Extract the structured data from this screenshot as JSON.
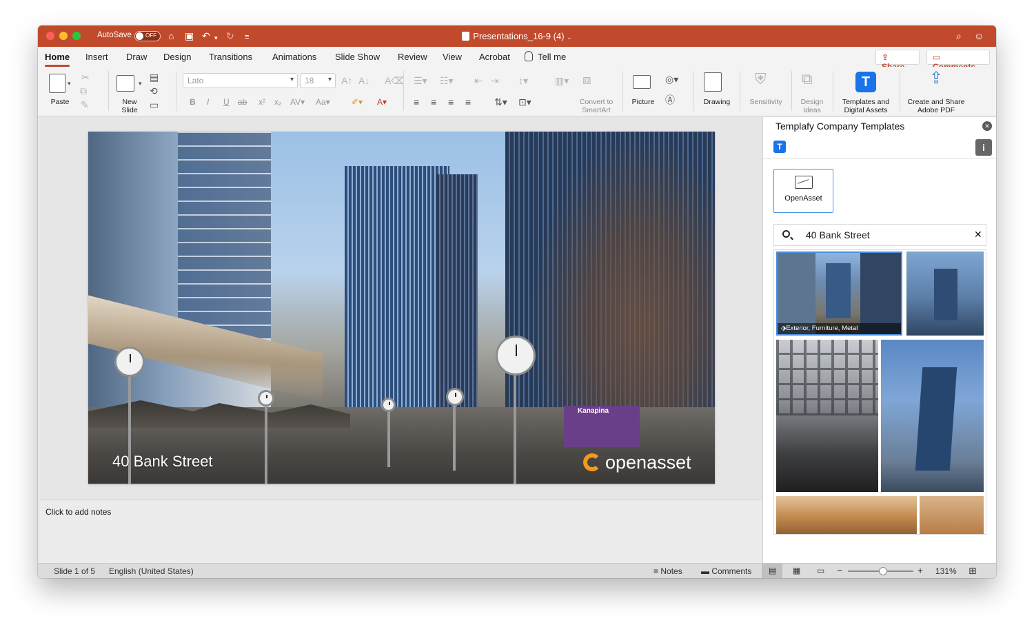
{
  "titlebar": {
    "autosave_label": "AutoSave",
    "autosave_state": "OFF",
    "document_title": "Presentations_16-9 (4)"
  },
  "tabs": [
    {
      "label": "Home",
      "active": true
    },
    {
      "label": "Insert"
    },
    {
      "label": "Draw"
    },
    {
      "label": "Design"
    },
    {
      "label": "Transitions"
    },
    {
      "label": "Animations"
    },
    {
      "label": "Slide Show"
    },
    {
      "label": "Review"
    },
    {
      "label": "View"
    },
    {
      "label": "Acrobat"
    },
    {
      "label": "Tell me"
    }
  ],
  "actions": {
    "share": "Share",
    "comments": "Comments"
  },
  "ribbon": {
    "paste": "Paste",
    "new_slide": "New Slide",
    "font_name": "Lato",
    "font_size": "18",
    "convert_smartart": "Convert to SmartArt",
    "picture": "Picture",
    "drawing": "Drawing",
    "sensitivity": "Sensitivity",
    "design_ideas": "Design Ideas",
    "templates_assets": "Templates and Digital Assets",
    "create_share_pdf": "Create and Share Adobe PDF",
    "templafy_letter": "T"
  },
  "slide": {
    "caption": "40 Bank Street",
    "logo_text": "openasset",
    "kiosk_text": "Kanapina"
  },
  "notes": {
    "placeholder": "Click to add notes"
  },
  "panel": {
    "title": "Templafy Company Templates",
    "source_label": "OpenAsset",
    "search_value": "40 Bank Street",
    "first_result_tags": "Exterior, Furniture, Metal",
    "logo_letter": "T"
  },
  "status": {
    "slide_position": "Slide 1 of 5",
    "language": "English (United States)",
    "notes": "Notes",
    "comments": "Comments",
    "zoom": "131%"
  },
  "colors": {
    "accent": "#c24a2c",
    "templafy_blue": "#1a73e8",
    "openasset_orange": "#f39a1b"
  }
}
